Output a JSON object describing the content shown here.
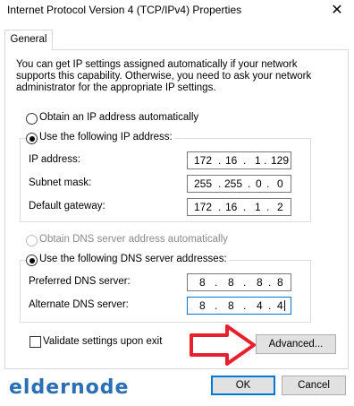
{
  "window": {
    "title": "Internet Protocol Version 4 (TCP/IPv4) Properties",
    "close_glyph": "✕"
  },
  "tabs": [
    {
      "label": "General"
    }
  ],
  "description": "You can get IP settings assigned automatically if your network supports this capability. Otherwise, you need to ask your network administrator for the appropriate IP settings.",
  "ip": {
    "auto_label": "Obtain an IP address automatically",
    "manual_label": "Use the following IP address:",
    "selected": "manual",
    "fields": [
      {
        "label": "IP address:",
        "octets": [
          "172",
          "16",
          "1",
          "129"
        ]
      },
      {
        "label": "Subnet mask:",
        "octets": [
          "255",
          "255",
          "0",
          "0"
        ]
      },
      {
        "label": "Default gateway:",
        "octets": [
          "172",
          "16",
          "1",
          "2"
        ]
      }
    ]
  },
  "dns": {
    "auto_label": "Obtain DNS server address automatically",
    "manual_label": "Use the following DNS server addresses:",
    "selected": "manual",
    "fields": [
      {
        "label": "Preferred DNS server:",
        "octets": [
          "8",
          "8",
          "8",
          "8"
        ]
      },
      {
        "label": "Alternate DNS server:",
        "octets": [
          "8",
          "8",
          "4",
          "4"
        ]
      }
    ]
  },
  "validate_label": "Validate settings upon exit",
  "validate_checked": false,
  "buttons": {
    "advanced": "Advanced...",
    "ok": "OK",
    "cancel": "Cancel"
  },
  "logo": {
    "text": "eldernode"
  },
  "colors": {
    "accent": "#0078d7",
    "arrow": "#e8202e",
    "logo": "#2a6fb5"
  }
}
